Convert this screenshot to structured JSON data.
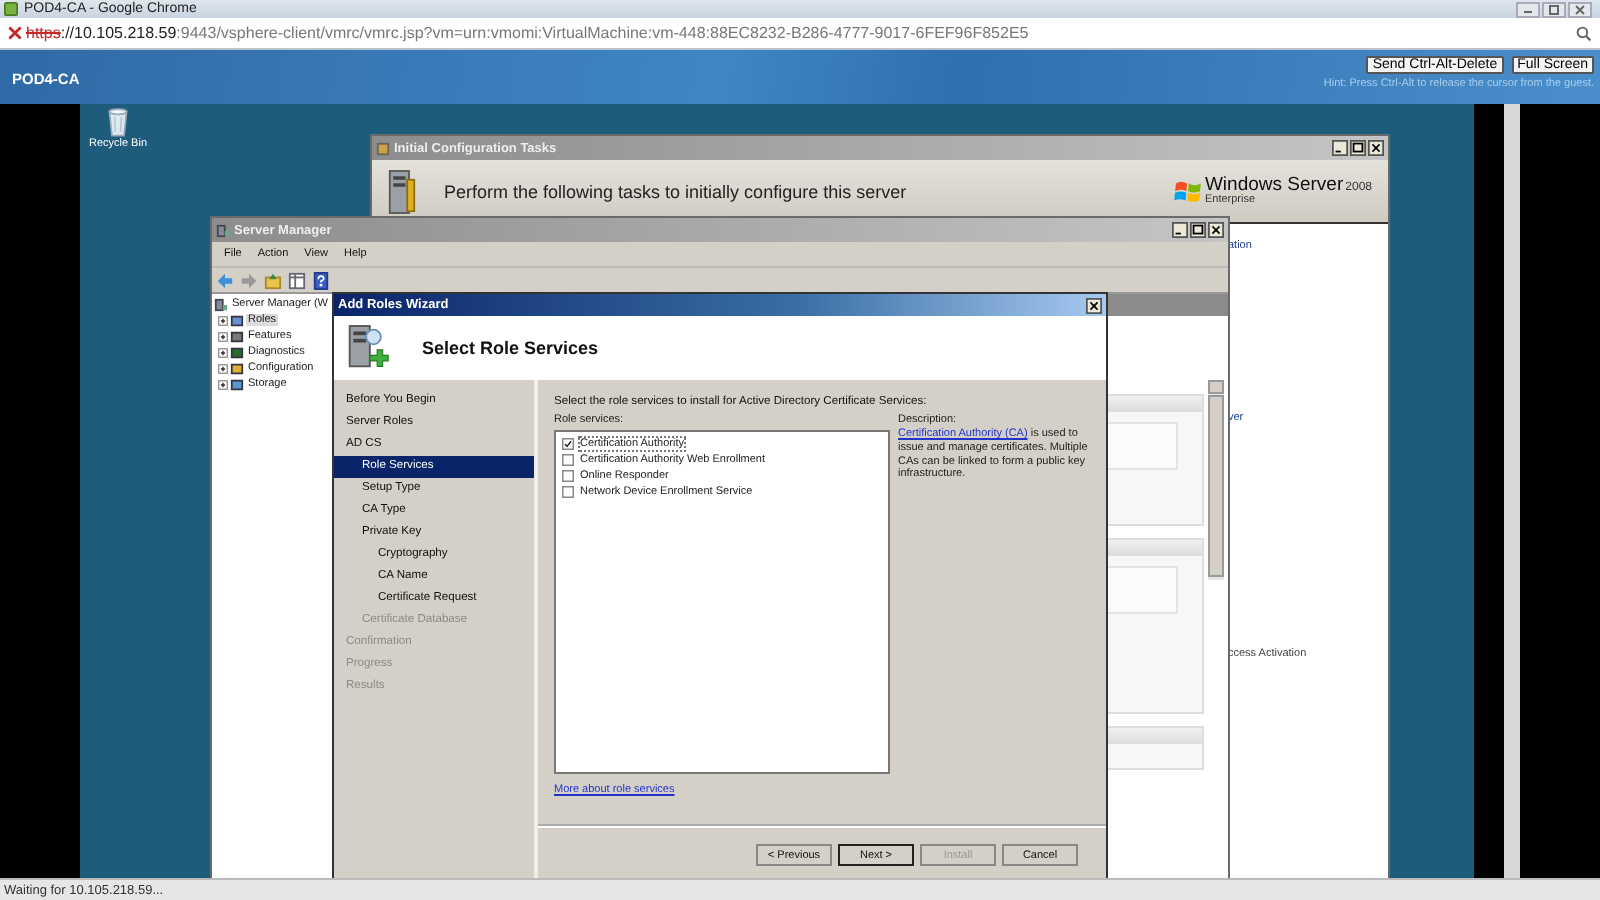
{
  "browser": {
    "title": "POD4-CA - Google Chrome",
    "url": {
      "scheme": "https",
      "host": "://10.105.218.59",
      "rest": ":9443/vsphere-client/vmrc/vmrc.jsp?vm=urn:vmomi:VirtualMachine:vm-448:88EC8232-B286-4777-9017-6FEF96F852E5",
      "insecure": true
    },
    "status": "Waiting for 10.105.218.59..."
  },
  "console": {
    "name": "POD4-CA",
    "buttons": [
      "Send Ctrl-Alt-Delete",
      "Full Screen"
    ],
    "hint": "Hint: Press Ctrl-Alt to release the cursor from the guest."
  },
  "desktop": {
    "icons": [
      {
        "label": "Recycle Bin"
      }
    ]
  },
  "initial_config": {
    "title": "Initial Configuration Tasks",
    "heading": "Perform the following tasks to initially configure this server",
    "logo": {
      "name": "Windows Server",
      "version": "2008",
      "edition": "Enterprise"
    },
    "fragments": [
      {
        "text": "ation",
        "kind": "link"
      },
      {
        "text": "ver",
        "kind": "link"
      },
      {
        "text": "ccess Activation",
        "kind": "text"
      }
    ]
  },
  "server_manager": {
    "title": "Server Manager",
    "menu": [
      "File",
      "Action",
      "View",
      "Help"
    ],
    "tree": {
      "label": "Server Manager (W",
      "children": [
        {
          "label": "Roles",
          "selected": true
        },
        {
          "label": "Features",
          "selected": false
        },
        {
          "label": "Diagnostics",
          "selected": false
        },
        {
          "label": "Configuration",
          "selected": false
        },
        {
          "label": "Storage",
          "selected": false
        }
      ]
    }
  },
  "wizard": {
    "title": "Add Roles Wizard",
    "heading": "Select Role Services",
    "steps": [
      {
        "label": "Before You Begin",
        "selected": false,
        "disabled": false
      },
      {
        "label": "Server Roles",
        "selected": false,
        "disabled": false
      },
      {
        "label": "AD CS",
        "selected": false,
        "disabled": false,
        "children": [
          {
            "label": "Role Services",
            "selected": true,
            "disabled": false
          },
          {
            "label": "Setup Type",
            "selected": false,
            "disabled": false
          },
          {
            "label": "CA Type",
            "selected": false,
            "disabled": false
          },
          {
            "label": "Private Key",
            "selected": false,
            "disabled": false,
            "children": [
              {
                "label": "Cryptography",
                "selected": false,
                "disabled": false
              },
              {
                "label": "CA Name",
                "selected": false,
                "disabled": false
              },
              {
                "label": "Certificate Request",
                "selected": false,
                "disabled": false
              }
            ]
          },
          {
            "label": "Certificate Database",
            "selected": false,
            "disabled": true
          }
        ]
      },
      {
        "label": "Confirmation",
        "selected": false,
        "disabled": true
      },
      {
        "label": "Progress",
        "selected": false,
        "disabled": true
      },
      {
        "label": "Results",
        "selected": false,
        "disabled": true
      }
    ],
    "instruction": "Select the role services to install for Active Directory Certificate Services:",
    "list_label": "Role services:",
    "role_services": [
      {
        "label": "Certification Authority",
        "checked": true
      },
      {
        "label": "Certification Authority Web Enrollment",
        "checked": false
      },
      {
        "label": "Online Responder",
        "checked": false
      },
      {
        "label": "Network Device Enrollment Service",
        "checked": false
      }
    ],
    "description_label": "Description:",
    "description": {
      "link": "Certification Authority (CA)",
      "text": " is used to issue and manage certificates. Multiple CAs can be linked to form a public key infrastructure."
    },
    "more_link": "More about role services",
    "buttons": [
      {
        "label": "< Previous",
        "disabled": false,
        "default": false
      },
      {
        "label": "Next >",
        "disabled": false,
        "default": true
      },
      {
        "label": "Install",
        "disabled": true,
        "default": false
      },
      {
        "label": "Cancel",
        "disabled": false,
        "default": false
      }
    ]
  }
}
